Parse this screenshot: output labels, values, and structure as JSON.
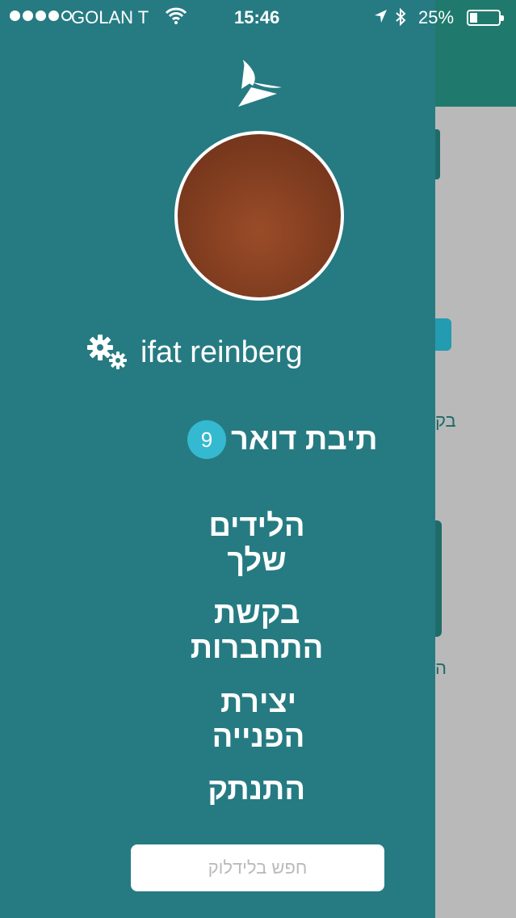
{
  "status_bar": {
    "carrier": "GOLAN T",
    "time": "15:46",
    "battery": "25%"
  },
  "user": {
    "name": "ifat reinberg"
  },
  "menu": {
    "mailbox": {
      "label": "תיבת דואר",
      "badge": "9"
    },
    "kids": "הלידים שלך",
    "connection_request": "בקשת התחברות",
    "create_request": "יצירת הפנייה",
    "logout": "התנתק"
  },
  "search": {
    "placeholder": "חפש בלידלוק"
  },
  "background": {
    "text1": "בק",
    "text2": "ה"
  },
  "colors": {
    "drawer": "#267b82",
    "badge": "#35b9d1",
    "header": "#1f7a6d"
  },
  "icons": [
    "signal-dots-icon",
    "wifi-icon",
    "location-arrow-icon",
    "bluetooth-icon",
    "battery-icon",
    "app-logo-icon",
    "gears-icon"
  ]
}
